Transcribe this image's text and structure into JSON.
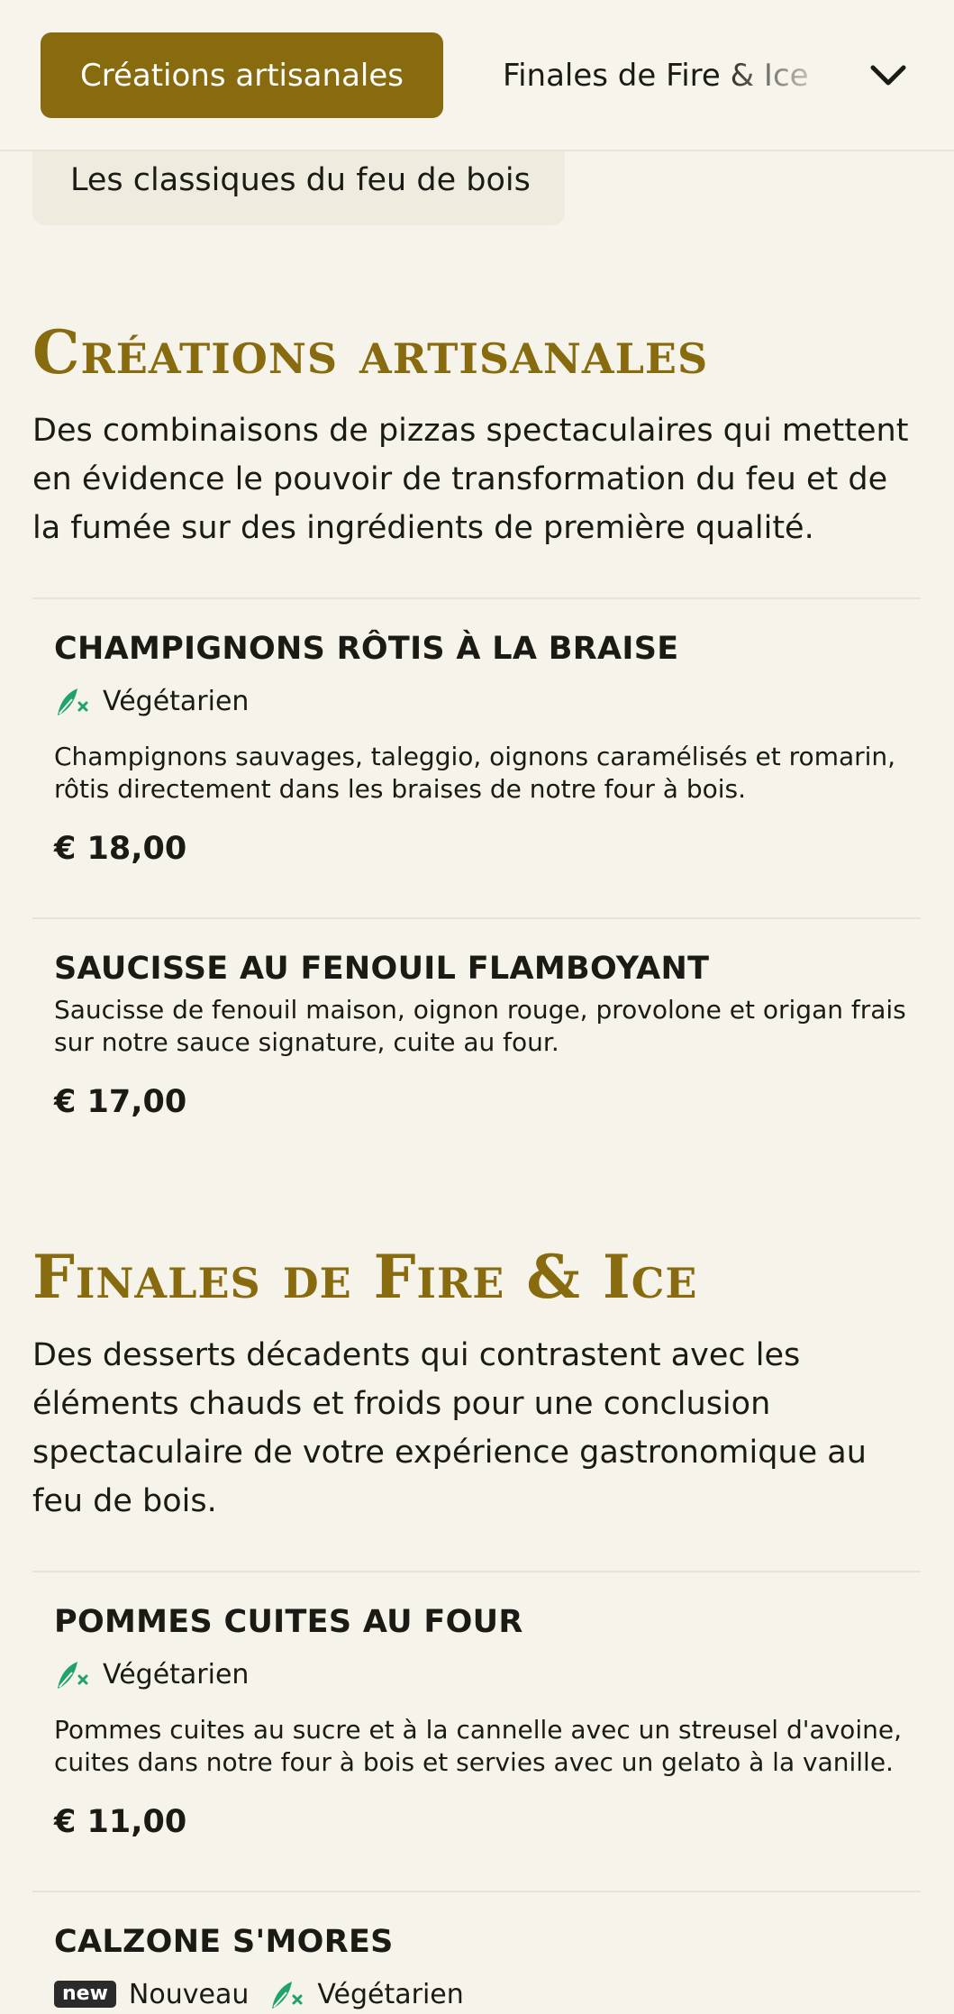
{
  "nav": {
    "active_tab": "Créations artisanales",
    "next_tab": "Finales de Fire & Ice",
    "peek_tab": "Les classiques du feu de bois"
  },
  "sections": [
    {
      "title": "Créations artisanales",
      "description": "Des combinaisons de pizzas spectaculaires qui mettent en évidence le pouvoir de transformation du feu et de la fumée sur des ingrédients de première qualité.",
      "items": [
        {
          "name": "CHAMPIGNONS RÔTIS À LA BRAISE",
          "veg_label": "Végétarien",
          "description": "Champignons sauvages, taleggio, oignons caramélisés et romarin, rôtis directement dans les braises de notre four à bois.",
          "price": "€ 18,00"
        },
        {
          "name": "SAUCISSE AU FENOUIL FLAMBOYANT",
          "description": "Saucisse de fenouil maison, oignon rouge, provolone et origan frais sur notre sauce signature, cuite au four.",
          "price": "€ 17,00"
        }
      ]
    },
    {
      "title": "Finales de Fire & Ice",
      "description": "Des desserts décadents qui contrastent avec les éléments chauds et froids pour une conclusion spectaculaire de votre expérience gastronomique au feu de bois.",
      "items": [
        {
          "name": "POMMES CUITES AU FOUR",
          "veg_label": "Végétarien",
          "description": "Pommes cuites au sucre et à la cannelle avec un streusel d'avoine, cuites dans notre four à bois et servies avec un gelato à la vanille.",
          "price": "€ 11,00"
        },
        {
          "name": "CALZONE S'MORES",
          "new_tag": "new",
          "new_label": "Nouveau",
          "veg_label": "Végétarien"
        }
      ]
    }
  ],
  "colors": {
    "accent": "#876b0e",
    "background": "#f6f3eb",
    "veg_green": "#1fa36a"
  },
  "icons": {
    "veg": "vegetarian-leaf-icon",
    "expand": "chevron-down-icon"
  }
}
